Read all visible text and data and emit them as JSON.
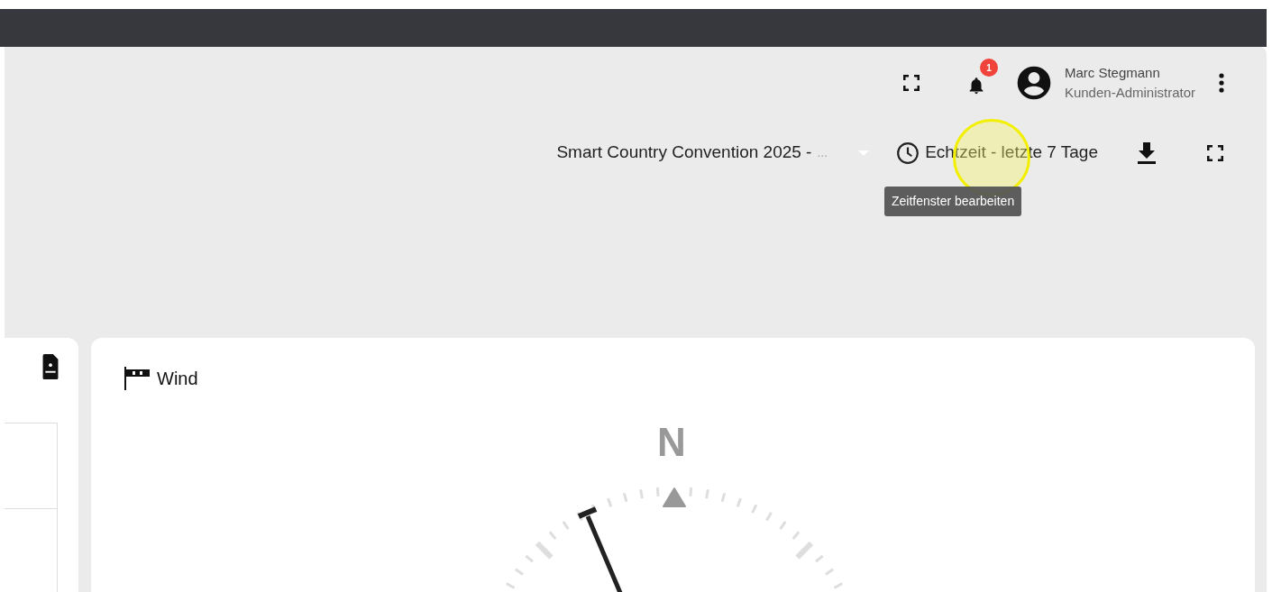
{
  "header": {
    "notification_count": "1",
    "user": {
      "name": "Marc Stegmann",
      "role": "Kunden-Administrator"
    }
  },
  "toolbar": {
    "dashboard_select": {
      "label": "Smart Country Convention 2025 -",
      "ellipsis": "..."
    },
    "time_range": "Echtzeit - letzte 7 Tage",
    "tooltip": "Zeitfenster bearbeiten"
  },
  "wind_card": {
    "title": "Wind",
    "compass_label": "N"
  }
}
